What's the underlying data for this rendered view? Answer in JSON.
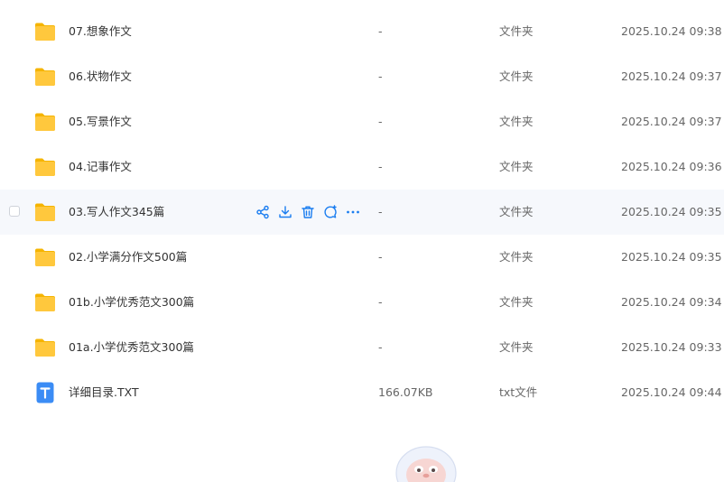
{
  "accent_color": "#1a7df0",
  "folder_color": "#ffc83d",
  "rows": [
    {
      "name": "07.想象作文",
      "size": "-",
      "type": "文件夹",
      "date": "2025.10.24 09:38",
      "icon": "folder-icon"
    },
    {
      "name": "06.状物作文",
      "size": "-",
      "type": "文件夹",
      "date": "2025.10.24 09:37",
      "icon": "folder-icon"
    },
    {
      "name": "05.写景作文",
      "size": "-",
      "type": "文件夹",
      "date": "2025.10.24 09:37",
      "icon": "folder-icon"
    },
    {
      "name": "04.记事作文",
      "size": "-",
      "type": "文件夹",
      "date": "2025.10.24 09:36",
      "icon": "folder-icon"
    },
    {
      "name": "03.写人作文345篇",
      "size": "-",
      "type": "文件夹",
      "date": "2025.10.24 09:35",
      "icon": "folder-icon",
      "hovered": true
    },
    {
      "name": "02.小学满分作文500篇",
      "size": "-",
      "type": "文件夹",
      "date": "2025.10.24 09:35",
      "icon": "folder-icon"
    },
    {
      "name": "01b.小学优秀范文300篇",
      "size": "-",
      "type": "文件夹",
      "date": "2025.10.24 09:34",
      "icon": "folder-icon"
    },
    {
      "name": "01a.小学优秀范文300篇",
      "size": "-",
      "type": "文件夹",
      "date": "2025.10.24 09:33",
      "icon": "folder-icon"
    },
    {
      "name": "详细目录.TXT",
      "size": "166.07KB",
      "type": "txt文件",
      "date": "2025.10.24 09:44",
      "icon": "txt-file-icon"
    }
  ],
  "row_actions": [
    "share-icon",
    "download-icon",
    "delete-icon",
    "comment-icon",
    "more-icon"
  ]
}
